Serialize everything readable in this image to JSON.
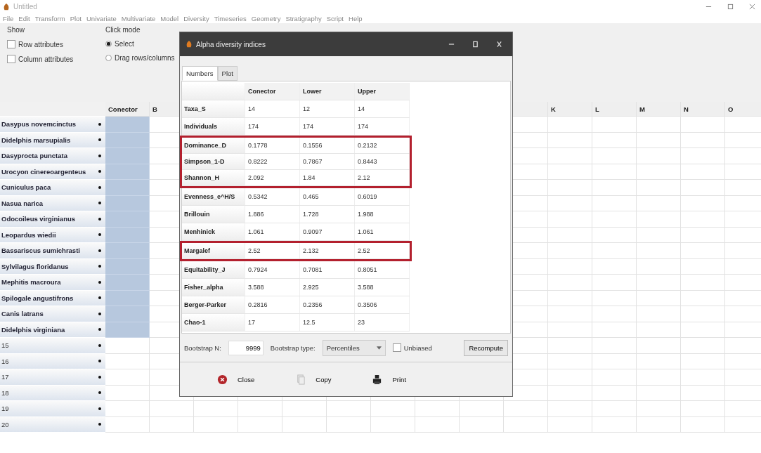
{
  "window": {
    "title": "Untitled"
  },
  "menu": [
    "File",
    "Edit",
    "Transform",
    "Plot",
    "Univariate",
    "Multivariate",
    "Model",
    "Diversity",
    "Timeseries",
    "Geometry",
    "Stratigraphy",
    "Script",
    "Help"
  ],
  "show_panel": {
    "title": "Show",
    "options": [
      {
        "label": "Row attributes",
        "checked": false
      },
      {
        "label": "Column attributes",
        "checked": false
      }
    ]
  },
  "click_mode_panel": {
    "title": "Click mode",
    "options": [
      {
        "label": "Select",
        "selected": true
      },
      {
        "label": "Drag rows/columns",
        "selected": false
      }
    ]
  },
  "sheet": {
    "left_columns": [
      "Conector",
      "B"
    ],
    "right_columns": [
      "K",
      "L",
      "M",
      "N",
      "O"
    ],
    "rows": [
      {
        "label": "Dasypus novemcinctus",
        "selected": true
      },
      {
        "label": "Didelphis marsupialis",
        "selected": true
      },
      {
        "label": "Dasyprocta punctata",
        "selected": true
      },
      {
        "label": "Urocyon cinereoargenteus",
        "selected": true
      },
      {
        "label": "Cuniculus paca",
        "selected": true
      },
      {
        "label": "Nasua narica",
        "selected": true
      },
      {
        "label": "Odocoileus virginianus",
        "selected": true
      },
      {
        "label": "Leopardus wiedii",
        "selected": true
      },
      {
        "label": "Bassariscus sumichrasti",
        "selected": true
      },
      {
        "label": "Sylvilagus floridanus",
        "selected": true
      },
      {
        "label": "Mephitis macroura",
        "selected": true
      },
      {
        "label": "Spilogale angustifrons",
        "selected": true
      },
      {
        "label": "Canis latrans",
        "selected": true
      },
      {
        "label": "Didelphis virginiana",
        "selected": true
      },
      {
        "label": "15",
        "selected": false
      },
      {
        "label": "16",
        "selected": false
      },
      {
        "label": "17",
        "selected": false
      },
      {
        "label": "18",
        "selected": false
      },
      {
        "label": "19",
        "selected": false
      },
      {
        "label": "20",
        "selected": false
      }
    ]
  },
  "dialog": {
    "title": "Alpha diversity indices",
    "tabs": [
      {
        "label": "Numbers",
        "selected": true
      },
      {
        "label": "Plot",
        "selected": false
      }
    ],
    "columns": [
      "Conector",
      "Lower",
      "Upper"
    ],
    "rows": [
      {
        "name": "Taxa_S",
        "values": [
          "14",
          "12",
          "14"
        ],
        "highlighted": false
      },
      {
        "name": "Individuals",
        "values": [
          "174",
          "174",
          "174"
        ],
        "highlighted": false
      },
      {
        "name": "Dominance_D",
        "values": [
          "0.1778",
          "0.1556",
          "0.2132"
        ],
        "highlighted": true
      },
      {
        "name": "Simpson_1-D",
        "values": [
          "0.8222",
          "0.7867",
          "0.8443"
        ],
        "highlighted": true
      },
      {
        "name": "Shannon_H",
        "values": [
          "2.092",
          "1.84",
          "2.12"
        ],
        "highlighted": true
      },
      {
        "name": "Evenness_e^H/S",
        "values": [
          "0.5342",
          "0.465",
          "0.6019"
        ],
        "highlighted": false
      },
      {
        "name": "Brillouin",
        "values": [
          "1.886",
          "1.728",
          "1.988"
        ],
        "highlighted": false
      },
      {
        "name": "Menhinick",
        "values": [
          "1.061",
          "0.9097",
          "1.061"
        ],
        "highlighted": false
      },
      {
        "name": "Margalef",
        "values": [
          "2.52",
          "2.132",
          "2.52"
        ],
        "highlighted": true
      },
      {
        "name": "Equitability_J",
        "values": [
          "0.7924",
          "0.7081",
          "0.8051"
        ],
        "highlighted": false
      },
      {
        "name": "Fisher_alpha",
        "values": [
          "3.588",
          "2.925",
          "3.588"
        ],
        "highlighted": false
      },
      {
        "name": "Berger-Parker",
        "values": [
          "0.2816",
          "0.2356",
          "0.3506"
        ],
        "highlighted": false
      },
      {
        "name": "Chao-1",
        "values": [
          "17",
          "12.5",
          "23"
        ],
        "highlighted": false
      }
    ],
    "bootstrap_n_label": "Bootstrap N:",
    "bootstrap_n": "9999",
    "bootstrap_type_label": "Bootstrap type:",
    "bootstrap_type": "Percentiles",
    "unbiased": {
      "label": "Unbiased",
      "checked": false
    },
    "recompute": "Recompute",
    "buttons": [
      {
        "kind": "close",
        "label": "Close"
      },
      {
        "kind": "copy",
        "label": "Copy"
      },
      {
        "kind": "print",
        "label": "Print"
      }
    ]
  }
}
